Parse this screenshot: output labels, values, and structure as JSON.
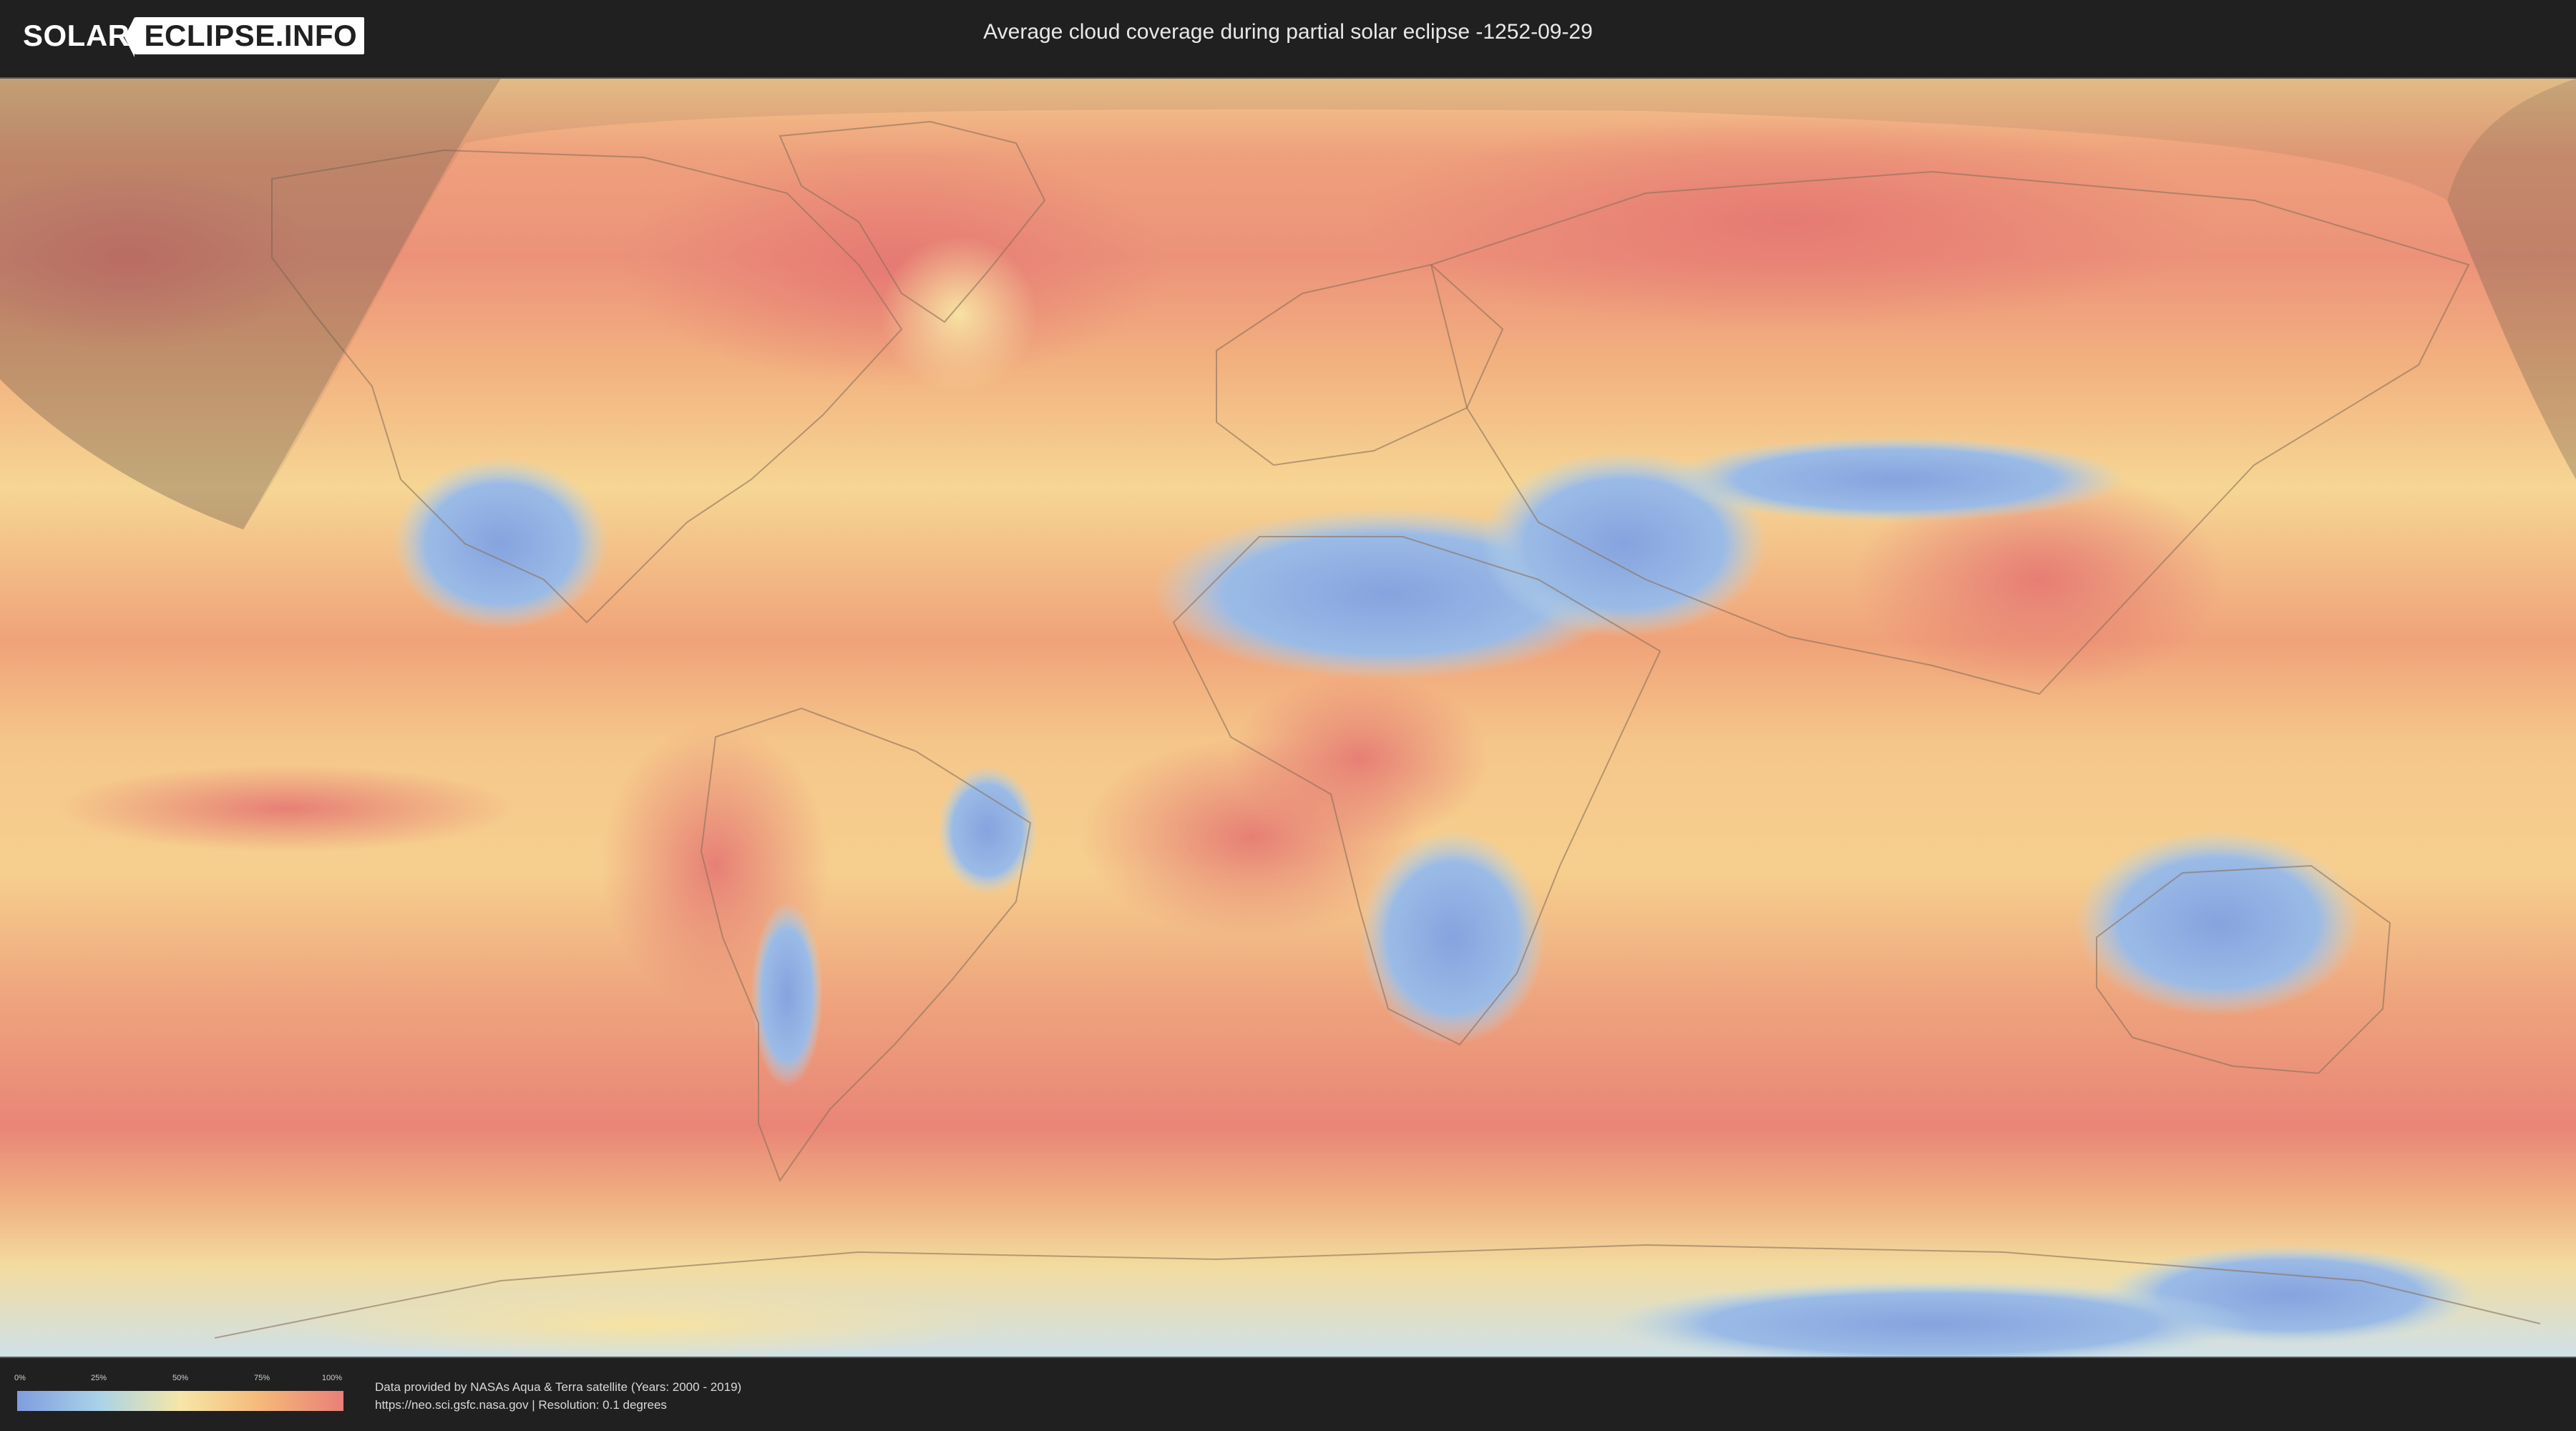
{
  "header": {
    "logo_left": "SOLAR",
    "logo_right": "ECLIPSE.INFO",
    "title": "Average cloud coverage during partial solar eclipse -1252-09-29"
  },
  "map": {
    "type": "cloud-coverage-world-map",
    "eclipse_shadow_overlay": true,
    "colors": {
      "clear": "#7f9ddf",
      "low": "#a9d2e8",
      "mid": "#f6e6a8",
      "high": "#f5b878",
      "overcast": "#e97f79"
    }
  },
  "legend": {
    "ticks": [
      "0%",
      "25%",
      "50%",
      "75%",
      "100%"
    ]
  },
  "footer": {
    "credit_line1": "Data provided by NASAs Aqua & Terra satellite (Years: 2000 - 2019)",
    "credit_line2": "https://neo.sci.gsfc.nasa.gov | Resolution: 0.1 degrees"
  }
}
